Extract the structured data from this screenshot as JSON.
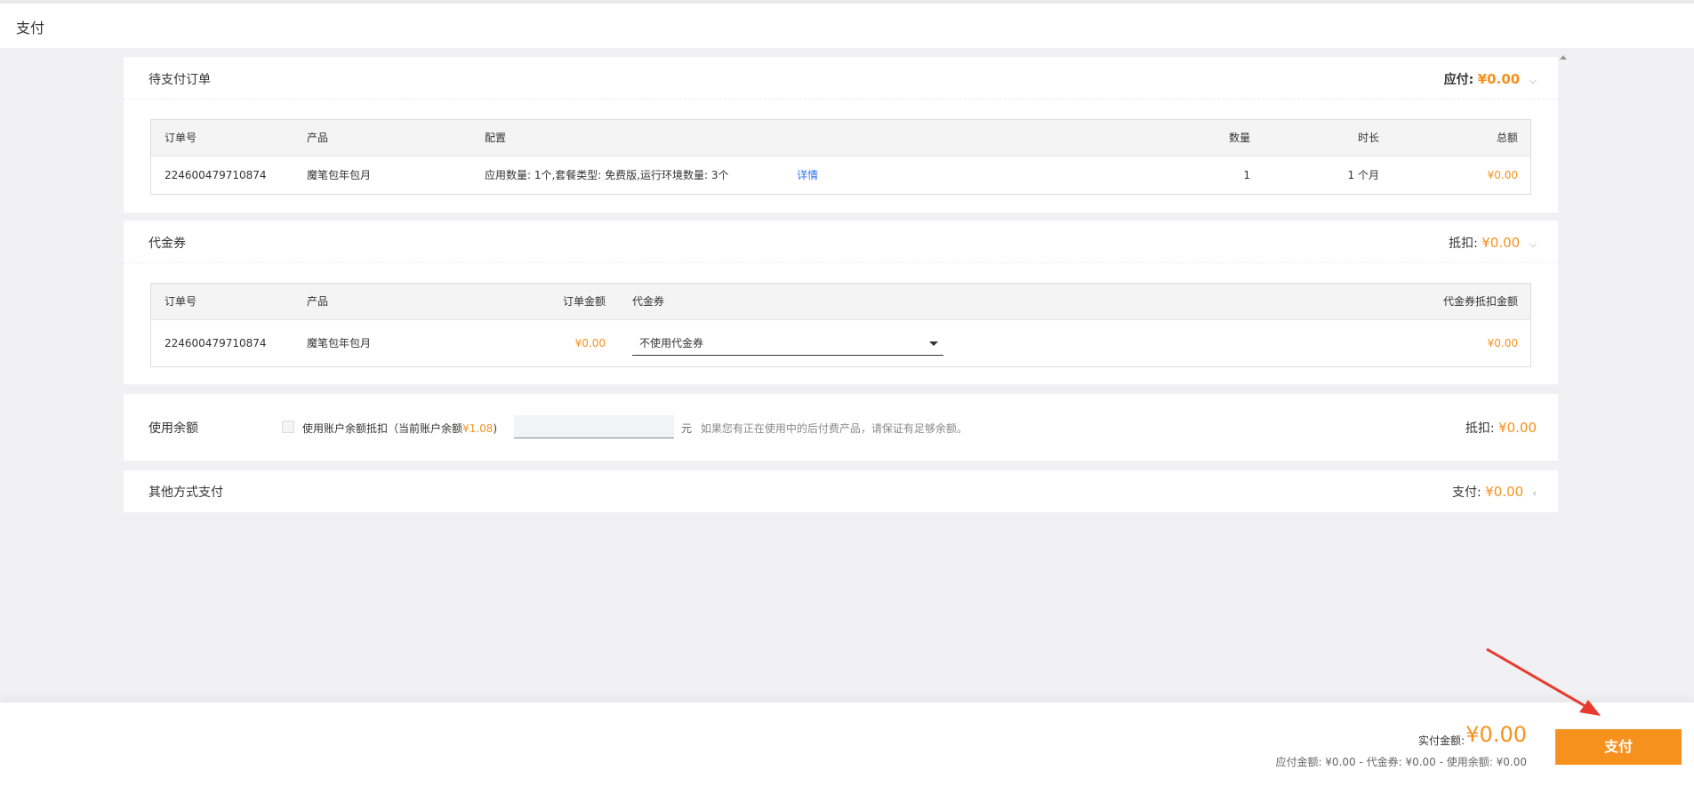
{
  "page": {
    "title": "支付"
  },
  "pending_orders": {
    "title": "待支付订单",
    "summary_label": "应付:",
    "summary_amount": "¥0.00",
    "columns": {
      "order_no": "订单号",
      "product": "产品",
      "config": "配置",
      "quantity": "数量",
      "duration": "时长",
      "total": "总额"
    },
    "rows": [
      {
        "order_no": "224600479710874",
        "product": "魔笔包年包月",
        "config": "应用数量: 1个,套餐类型: 免费版,运行环境数量: 3个",
        "detail_link": "详情",
        "quantity": "1",
        "duration": "1 个月",
        "total": "¥0.00"
      }
    ]
  },
  "voucher": {
    "title": "代金券",
    "summary_label": "抵扣:",
    "summary_amount": "¥0.00",
    "columns": {
      "order_no": "订单号",
      "product": "产品",
      "order_amount": "订单金额",
      "voucher": "代金券",
      "deduct_amount": "代金券抵扣金额"
    },
    "rows": [
      {
        "order_no": "224600479710874",
        "product": "魔笔包年包月",
        "order_amount": "¥0.00",
        "voucher_select": "不使用代金券",
        "deduct_amount": "¥0.00"
      }
    ]
  },
  "balance": {
    "title": "使用余额",
    "checkbox_label": "使用账户余额抵扣（当前账户余额",
    "current_balance": "¥1.08",
    "checkbox_label_end": ")",
    "input_value": "",
    "unit": "元",
    "hint": "如果您有正在使用中的后付费产品，请保证有足够余额。",
    "summary_label": "抵扣:",
    "summary_amount": "¥0.00"
  },
  "other_payment": {
    "title": "其他方式支付",
    "summary_label": "支付:",
    "summary_amount": "¥0.00"
  },
  "footer": {
    "actual_label": "实付金额:",
    "actual_amount": "¥0.00",
    "detail": "应付金额: ¥0.00 - 代金券: ¥0.00 - 使用余额: ¥0.00",
    "pay_button": "支付"
  },
  "colors": {
    "accent": "#f7911e",
    "link": "#2f6fed",
    "annotation_arrow": "#e83a2e"
  }
}
